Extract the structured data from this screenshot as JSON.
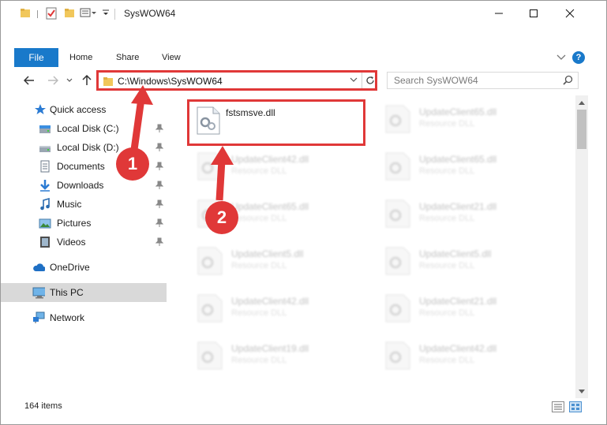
{
  "window": {
    "title": "SysWOW64"
  },
  "ribbon": {
    "tabs": [
      "File",
      "Home",
      "Share",
      "View"
    ],
    "help_label": "?"
  },
  "address": {
    "path": "C:\\Windows\\SysWOW64",
    "search_placeholder": "Search SysWOW64"
  },
  "nav": {
    "quick_access": "Quick access",
    "items": [
      {
        "label": "Local Disk (C:)",
        "icon": "drive-icon",
        "pinned": true
      },
      {
        "label": "Local Disk (D:)",
        "icon": "drive-icon",
        "pinned": true
      },
      {
        "label": "Documents",
        "icon": "documents-icon",
        "pinned": true
      },
      {
        "label": "Downloads",
        "icon": "downloads-icon",
        "pinned": true
      },
      {
        "label": "Music",
        "icon": "music-icon",
        "pinned": true
      },
      {
        "label": "Pictures",
        "icon": "pictures-icon",
        "pinned": true
      },
      {
        "label": "Videos",
        "icon": "videos-icon",
        "pinned": true
      }
    ],
    "onedrive": "OneDrive",
    "this_pc": "This PC",
    "network": "Network"
  },
  "files": {
    "highlighted": {
      "name": "fstsmsve.dll"
    },
    "left_column": [
      {
        "name": "UpdateClient42.dll",
        "desc": "Resource DLL"
      },
      {
        "name": "UpdateClient65.dll",
        "desc": "Resource DLL"
      },
      {
        "name": "UpdateClient5.dll",
        "desc": "Resource DLL"
      },
      {
        "name": "UpdateClient42.dll",
        "desc": "Resource DLL"
      },
      {
        "name": "UpdateClient19.dll",
        "desc": "Resource DLL"
      }
    ],
    "right_column": [
      {
        "name": "UpdateClient65.dll",
        "desc": "Resource DLL"
      },
      {
        "name": "UpdateClient65.dll",
        "desc": "Resource DLL"
      },
      {
        "name": "UpdateClient21.dll",
        "desc": "Resource DLL"
      },
      {
        "name": "UpdateClient5.dll",
        "desc": "Resource DLL"
      },
      {
        "name": "UpdateClient21.dll",
        "desc": "Resource DLL"
      },
      {
        "name": "UpdateClient42.dll",
        "desc": "Resource DLL"
      }
    ]
  },
  "status": {
    "item_count": "164 items"
  },
  "annotations": {
    "step1": "1",
    "step2": "2",
    "color": "#e03838"
  },
  "colors": {
    "accent": "#1979ca",
    "highlight": "#e03838",
    "selected_bg": "#d9d9d9"
  }
}
